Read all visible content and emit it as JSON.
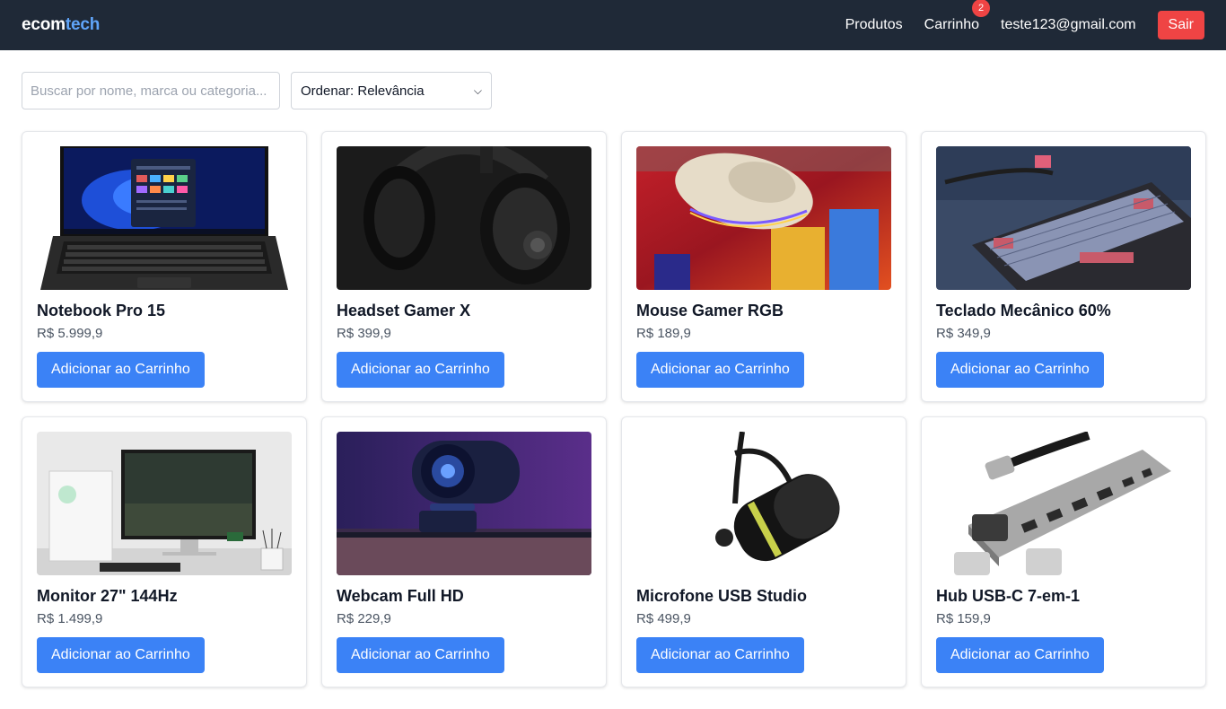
{
  "nav": {
    "brand_part1": "ecom",
    "brand_part2": "tech",
    "products_link": "Produtos",
    "cart_link": "Carrinho",
    "cart_count": "2",
    "user_email": "teste123@gmail.com",
    "logout_label": "Sair"
  },
  "filters": {
    "search_placeholder": "Buscar por nome, marca ou categoria...",
    "sort_value": "Ordenar: Relevância"
  },
  "products": [
    {
      "name": "Notebook Pro 15",
      "price": "R$ 5.999,9",
      "button": "Adicionar ao Carrinho"
    },
    {
      "name": "Headset Gamer X",
      "price": "R$ 399,9",
      "button": "Adicionar ao Carrinho"
    },
    {
      "name": "Mouse Gamer RGB",
      "price": "R$ 189,9",
      "button": "Adicionar ao Carrinho"
    },
    {
      "name": "Teclado Mecânico 60%",
      "price": "R$ 349,9",
      "button": "Adicionar ao Carrinho"
    },
    {
      "name": "Monitor 27\" 144Hz",
      "price": "R$ 1.499,9",
      "button": "Adicionar ao Carrinho"
    },
    {
      "name": "Webcam Full HD",
      "price": "R$ 229,9",
      "button": "Adicionar ao Carrinho"
    },
    {
      "name": "Microfone USB Studio",
      "price": "R$ 499,9",
      "button": "Adicionar ao Carrinho"
    },
    {
      "name": "Hub USB-C 7-em-1",
      "price": "R$ 159,9",
      "button": "Adicionar ao Carrinho"
    }
  ],
  "colors": {
    "navbar_bg": "#1f2937",
    "brand_accent": "#60a5fa",
    "primary_button": "#3b82f6",
    "danger": "#ef4444"
  }
}
